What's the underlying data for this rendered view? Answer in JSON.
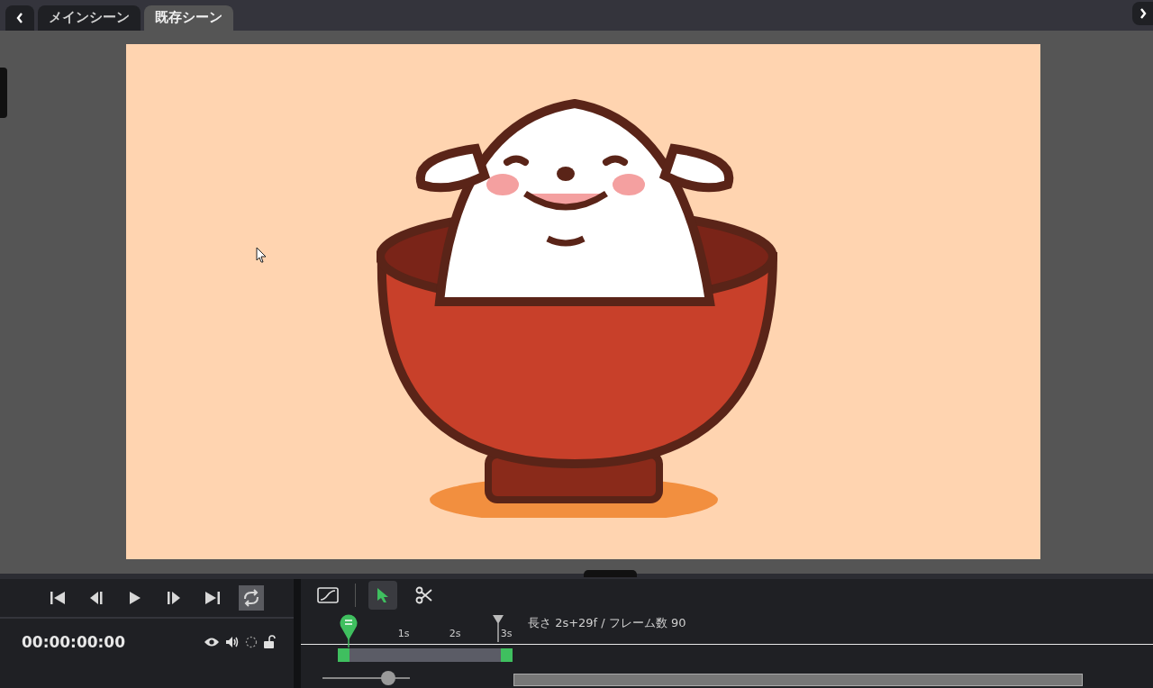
{
  "tabs": [
    {
      "label": "メインシーン",
      "selected": false
    },
    {
      "label": "既存シーン",
      "selected": true
    }
  ],
  "transport": {
    "loop_on": true
  },
  "timecode": "00:00:00:00",
  "tools": [
    {
      "kind": "easing",
      "selected": false
    },
    {
      "kind": "select",
      "selected": true
    },
    {
      "kind": "cut",
      "selected": false
    }
  ],
  "ruler": {
    "ticks": [
      "1s",
      "2s",
      "3s"
    ]
  },
  "info": "長さ 2s+29f / フレーム数 90",
  "zoom": {
    "level": 0.75
  }
}
